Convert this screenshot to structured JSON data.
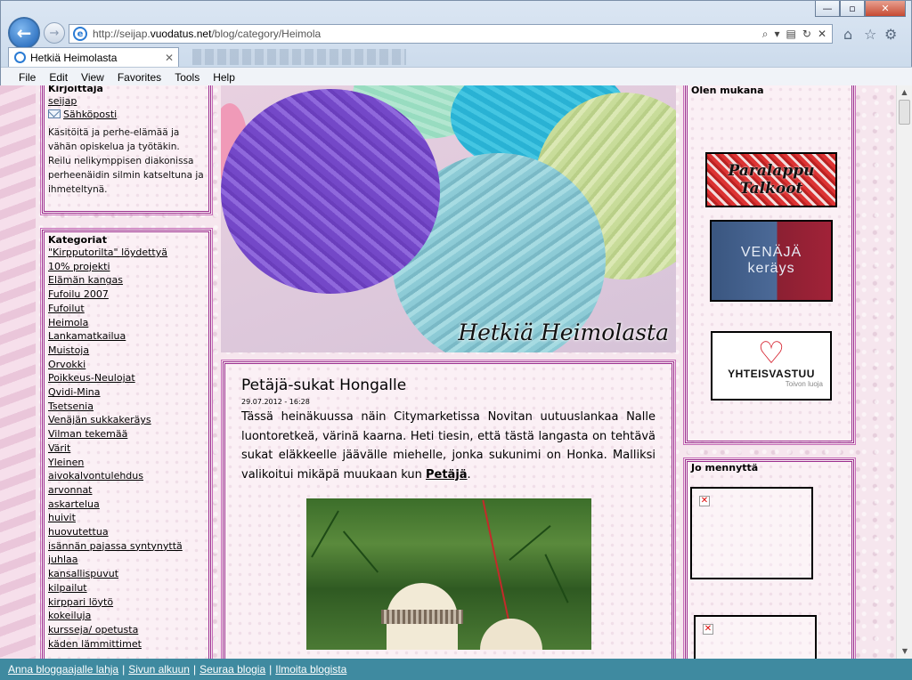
{
  "browser": {
    "address_scheme": "http://seijap.",
    "address_domain": "vuodatus.net",
    "address_path": "/blog/category/Heimola",
    "tab_title": "Hetkiä Heimolasta",
    "menu": [
      "File",
      "Edit",
      "View",
      "Favorites",
      "Tools",
      "Help"
    ],
    "icons": {
      "back": "back-arrow-icon",
      "forward": "forward-arrow-icon",
      "home": "home-icon",
      "favorites": "star-icon",
      "settings": "gear-icon"
    }
  },
  "left": {
    "author_title": "Kirjoittaja",
    "author_link": "seijap",
    "email_label": "Sähköposti",
    "author_desc": "Käsitöitä ja perhe-elämää ja vähän opiskelua ja työtäkin. Reilu nelikymppisen diakonissa perheenäidin silmin katseltuna ja ihmeteltynä.",
    "categories_title": "Kategoriat",
    "categories": [
      "\"Kirpputorilta\" löydettyä",
      "10% projekti",
      "Elämän kangas",
      "Fufoilu 2007",
      "Fufoilut",
      "Heimola",
      "Lankamatkailua",
      "Muistoja",
      "Orvokki",
      "Poikkeus-Neulojat",
      "Qvidi-Mina",
      "Tsetsenia",
      "Venäjän sukkakeräys",
      "Vilman tekemää",
      "Värit",
      "Yleinen",
      "aivokalvontulehdus",
      "arvonnat",
      "askartelua",
      "huivit",
      "huovutettua",
      "isännän pajassa syntynyttä",
      "juhlaa",
      "kansallispuvut",
      "kilpailut",
      "kirppari löytö",
      "kokeiluja",
      "kursseja/ opetusta",
      "käden lämmittimet"
    ]
  },
  "header": {
    "caption": "Hetkiä Heimolasta"
  },
  "post": {
    "title": "Petäjä-sukat Hongalle",
    "date": "29.07.2012 - 16:28",
    "body_text": "Tässä heinäkuussa näin Citymarketissa Novitan uutuuslankaa Nalle luontoretkeä, värinä kaarna. Heti tiesin, että tästä langasta on tehtävä sukat eläkkeelle jäävälle miehelle, jonka sukunimi on Honka. Malliksi valikoitui mikäpä muukaan kun",
    "link_text": "Petäjä",
    "end_punct": "."
  },
  "right": {
    "title_mukana": "Olen mukana",
    "banner_paralappu_l1": "Paralappu",
    "banner_paralappu_l2": "Talkoot",
    "banner_venaja_l1": "VENÄJÄ",
    "banner_venaja_l2": "keräys",
    "banner_yhteis_l1": "YHTEISVASTUU",
    "banner_yhteis_l2": "Toivon luoja",
    "title_mennytta": "Jo mennyttä"
  },
  "footer": {
    "links": [
      "Anna bloggaajalle lahja",
      "Sivun alkuun",
      "Seuraa blogia",
      "Ilmoita blogista"
    ]
  }
}
